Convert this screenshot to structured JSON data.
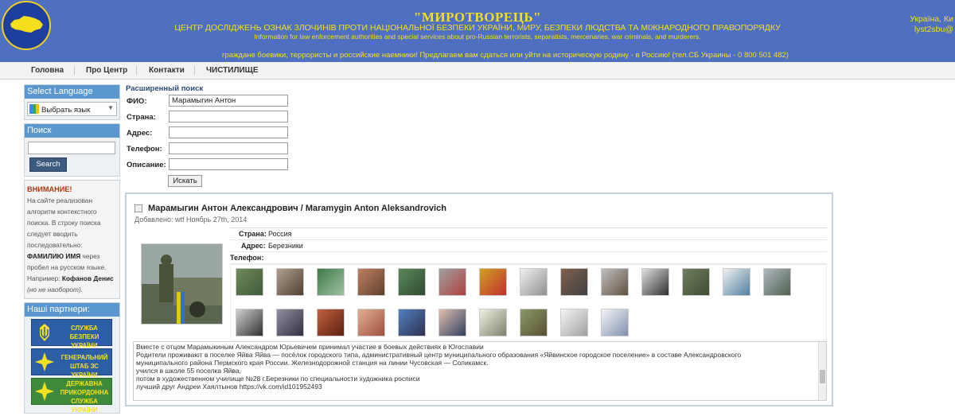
{
  "header": {
    "title": "\"МИРОТВОРЕЦЬ\"",
    "subtitle": "ЦЕНТР ДОСЛІДЖЕНЬ ОЗНАК ЗЛОЧИНІВ ПРОТИ НАЦІОНАЛЬНОЇ БЕЗПЕКИ УКРАЇНИ, МИРУ, БЕЗПЕКИ ЛЮДСТВА ТА МІЖНАРОДНОГО ПРАВОПОРЯДКУ",
    "info": "Information for law enforcement authorities and special services about pro-Russian terrorists, separatists, mercenaries, war criminals, and murderers.",
    "slogan": "граждане боевики, террористы и российские наемники! Предлагаем вам сдаться или уйти на историческую родину - в Россию! (тел.СБ Украины - 0 800 501 482)",
    "corner_line1": "Україна, Ки",
    "corner_line2": "lyst2sbu@",
    "brand_color": "#4f6fc0",
    "accent_color": "#f3e01b"
  },
  "nav": {
    "items": [
      {
        "label": "Головна"
      },
      {
        "label": "Про Центр"
      },
      {
        "label": "Контакти"
      },
      {
        "label": "ЧИСТИЛИЩЕ"
      }
    ]
  },
  "sidebar": {
    "language": {
      "title": "Select Language",
      "selected": "Выбрать язык",
      "icon": "google-translate-icon"
    },
    "search": {
      "title": "Поиск",
      "button": "Search"
    },
    "notice": {
      "warning": "ВНИМАНИЕ!",
      "text1": "На сайте реализован алгоритм контекстного поиска. В строку поиска следует вводить последовательно:",
      "bold1": "ФАМИЛИЮ ИМЯ",
      "text2": "через пробел на русском языке. Например:",
      "bold2": "Кофанов Денис",
      "italic": "(но не наоборот)."
    },
    "partners": {
      "title": "Наші партнери:",
      "items": [
        {
          "line1": "СЛУЖБА БЕЗПЕКИ",
          "line2": "УКРАЇНИ"
        },
        {
          "line1": "ГЕНЕРАЛЬНИЙ",
          "line2": "ШТАБ ЗС УКРАЇНИ"
        },
        {
          "line1": "ДЕРЖАВНА",
          "line2": "ПРИКОРДОННА",
          "line3": "СЛУЖБА УКРАЇНИ"
        }
      ]
    }
  },
  "search_form": {
    "title": "Расширенный поиск",
    "fio_label": "ФИО:",
    "fio_value": "Марамыгин Антон",
    "country_label": "Страна:",
    "address_label": "Адрес:",
    "phone_label": "Телефон:",
    "description_label": "Описание:",
    "submit": "Искать"
  },
  "result": {
    "title": "Марамыгин Антон Александрович / Maramygin Anton Aleksandrovich",
    "date": "Добавлено: wtf Ноябрь 27th, 2014",
    "country_label": "Страна:",
    "country_value": "Россия",
    "address_label": "Адрес:",
    "address_value": "Березники",
    "phone_label": "Телефон:",
    "phone_value": "",
    "description": [
      "Вместе с отцом Марамыкиным Александром Юрьевичем принимал участие в боевых действиях в Югославии",
      "Родители проживают в поселке Яйва Яйва — посёлок городского типа, административный центр муниципального образования «Яйвинское городское поселение» в составе Александровского",
      "муниципального района Пермского края России. Железнодорожной станция на линии Чусовская — Соликамск.",
      "учился в школе 55 поселка Яйва,",
      "потом в художественном училище №28 г.Березники по специальности художника росписи",
      "лучший друг Андреи Хаялтынов https://vk.com/id101952493"
    ]
  }
}
